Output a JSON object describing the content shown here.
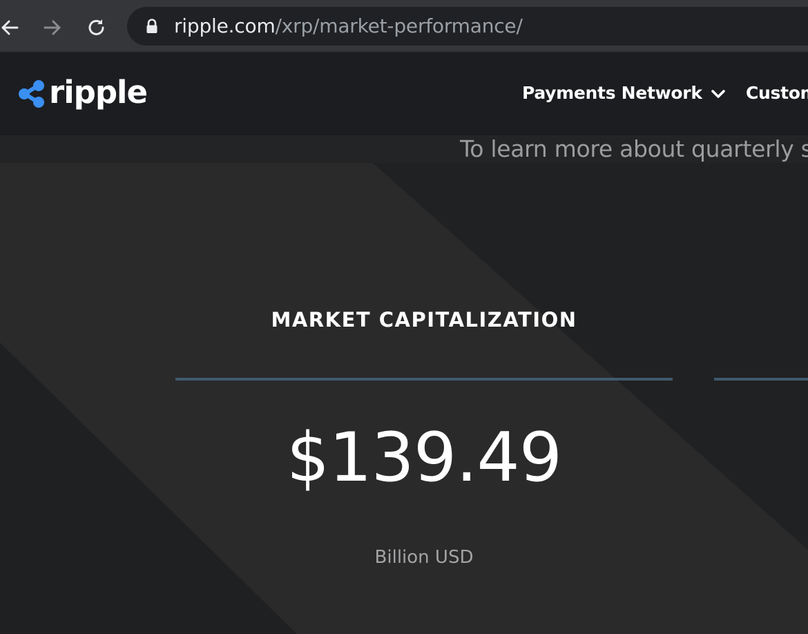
{
  "browser": {
    "url_host": "ripple.com",
    "url_path": "/xrp/market-performance/",
    "icons": [
      "back-arrow-icon",
      "forward-arrow-icon",
      "reload-icon",
      "lock-icon"
    ]
  },
  "header": {
    "logo_text": "ripple",
    "nav": [
      {
        "label": "Payments Network",
        "has_dropdown": true
      },
      {
        "label": "Custom",
        "has_dropdown": false
      }
    ]
  },
  "main": {
    "intro_text": "To learn more about quarterly sa",
    "stat": {
      "title": "MARKET CAPITALIZATION",
      "value": "$139.49",
      "unit": "Billion USD"
    }
  },
  "colors": {
    "brand_blue": "#3a8ff0",
    "header_bg": "#1b1d20",
    "page_bg": "#232425",
    "divider": "#3f5a6e",
    "browser_bar": "#35363a",
    "omnibox": "#202124"
  }
}
